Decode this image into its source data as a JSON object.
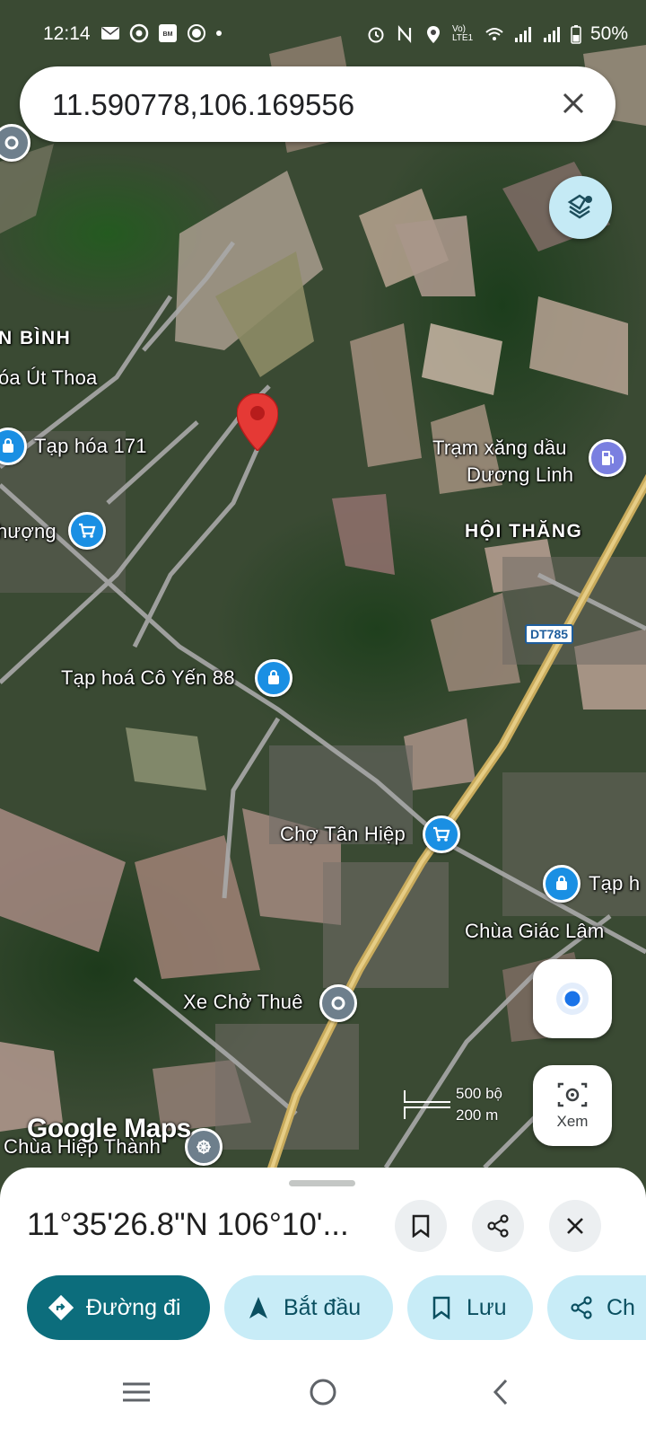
{
  "status_bar": {
    "time": "12:14",
    "battery": "50%",
    "network_label": "Vo) LTE1",
    "left_icons": [
      "gmail-icon",
      "chrome-icon",
      "baomoi-icon",
      "record-icon",
      "dot-icon"
    ],
    "right_icons": [
      "alarm-icon",
      "nfc-icon",
      "location-icon",
      "wifi-icon",
      "signal-icon",
      "signal-icon",
      "battery-icon"
    ]
  },
  "search": {
    "value": "11.590778,106.169556",
    "close_icon": "close-icon"
  },
  "map": {
    "labels": {
      "area_binh": "N BÌNH",
      "ut_thoa": "óa Út Thoa",
      "tap_hoa_171": "Tạp hóa 171",
      "thuong": "hượng",
      "tram_xang_1": "Trạm xăng dầu",
      "tram_xang_2": "Dương Linh",
      "hoi_thang": "HỘI THĂNG",
      "route": "DT785",
      "tap_hoa_co_yen": "Tạp hoá Cô Yến 88",
      "cho_tan_hiep": "Chợ Tân Hiệp",
      "tap_right": "Tạp h",
      "chua_giac_lam": "Chùa Giác Lâm",
      "xe_cho_thue": "Xe Chở Thuê",
      "chua_hiep_thanh": "Chùa Hiệp Thành"
    },
    "scale": {
      "feet": "500 bộ",
      "meters": "200 m"
    },
    "watermark": "Google Maps"
  },
  "controls": {
    "lens_label": "Xem"
  },
  "sheet": {
    "coords": "11°35'26.8\"N 106°10'...",
    "chips": {
      "directions": "Đường đi",
      "start": "Bắt đầu",
      "save": "Lưu",
      "share": "Ch"
    }
  },
  "colors": {
    "primary_chip": "#0c6d7c",
    "secondary_chip": "#c8ecf7",
    "pin_red": "#e53935",
    "pin_blue": "#1a8fe3",
    "road_yellow": "#d9bd6e"
  }
}
